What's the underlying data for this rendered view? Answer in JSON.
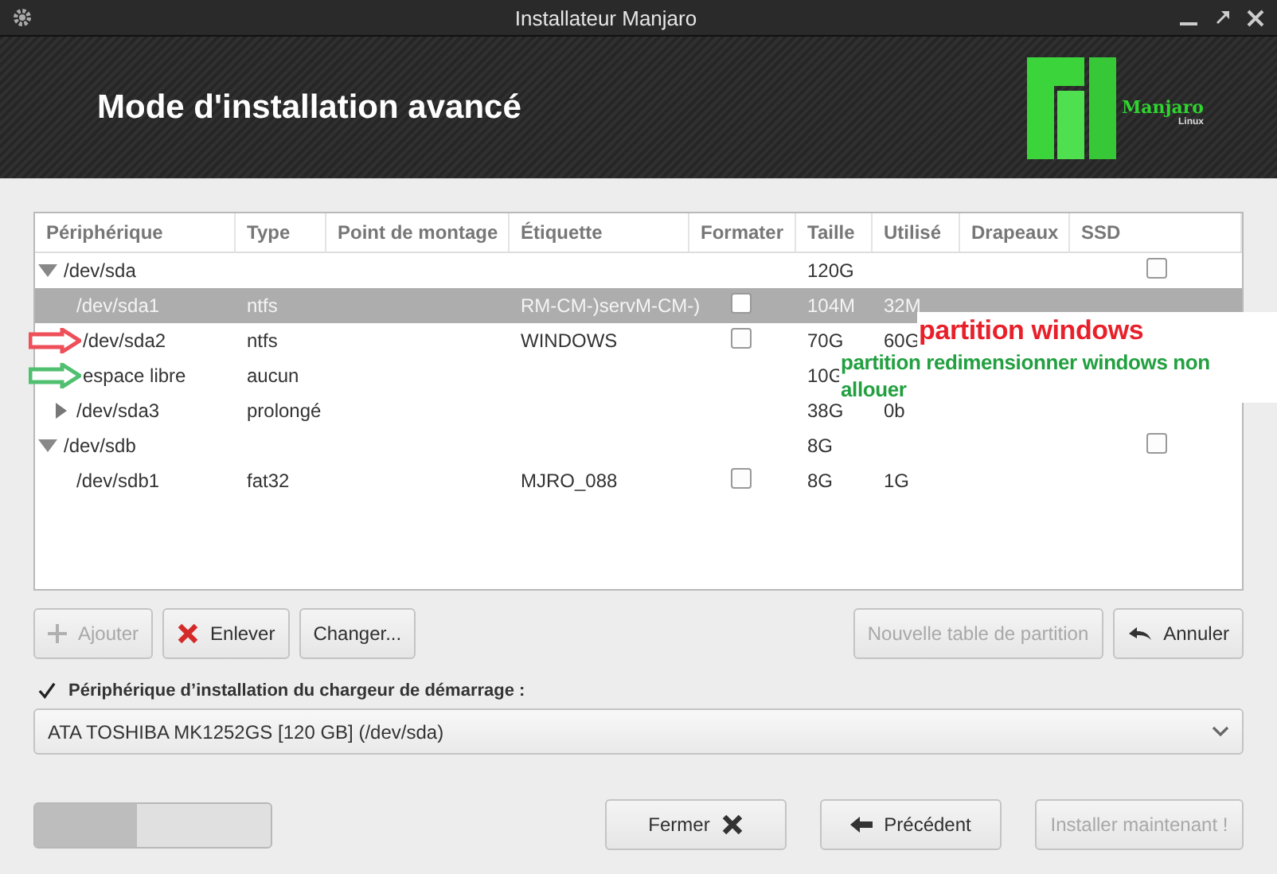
{
  "window": {
    "title": "Installateur Manjaro"
  },
  "header": {
    "title": "Mode d'installation avancé",
    "logo_name": "Manjaro",
    "logo_sub": "Linux"
  },
  "table": {
    "columns": [
      "Périphérique",
      "Type",
      "Point de montage",
      "Étiquette",
      "Formater",
      "Taille",
      "Utilisé",
      "Drapeaux",
      "SSD"
    ],
    "rows": [
      {
        "device": "/dev/sda",
        "size": "120G",
        "ssd": false,
        "expanded": true,
        "selected": false,
        "children": [
          {
            "device": "/dev/sda1",
            "type": "ntfs",
            "label": "RM-CM-)servM-CM-)",
            "format": false,
            "size": "104M",
            "used": "32M",
            "selected": true
          },
          {
            "device": "/dev/sda2",
            "type": "ntfs",
            "label": "WINDOWS",
            "format": false,
            "size": "70G",
            "used": "60G",
            "selected": false,
            "arrow": {
              "color": "#ee4f58"
            }
          },
          {
            "device": "espace libre",
            "type": "aucun",
            "size": "10G",
            "selected": false,
            "arrow": {
              "color": "#50c070"
            }
          },
          {
            "device": "/dev/sda3",
            "type": "prolongé",
            "size": "38G",
            "used": "0b",
            "expanded": false,
            "selected": false
          }
        ]
      },
      {
        "device": "/dev/sdb",
        "size": "8G",
        "ssd": false,
        "expanded": true,
        "selected": false,
        "children": [
          {
            "device": "/dev/sdb1",
            "type": "fat32",
            "label": "MJRO_088",
            "format": false,
            "size": "8G",
            "used": "1G",
            "selected": false
          }
        ]
      }
    ]
  },
  "note": [
    {
      "text": "partition windows",
      "color": "#e8202a"
    },
    {
      "text": "partition redimensionner windows non allouer",
      "color": "#22a040"
    }
  ],
  "actions": [
    {
      "label": "Ajouter",
      "disabled": true
    },
    {
      "label": "Enlever",
      "disabled": false
    },
    {
      "label": "Changer...",
      "disabled": false
    }
  ],
  "actions_right": [
    {
      "label": "Nouvelle table de partition",
      "disabled": true
    },
    {
      "label": "Annuler",
      "disabled": false
    }
  ],
  "bootloader": {
    "label": "Périphérique d’installation du chargeur de démarrage :",
    "checked": true,
    "value": "ATA TOSHIBA MK1252GS [120 GB] (/dev/sda)"
  },
  "progress": {
    "level": 0.43
  },
  "footer": [
    {
      "label": "Fermer",
      "disabled": false
    },
    {
      "label": "Précédent",
      "disabled": false
    },
    {
      "label": "Installer maintenant !",
      "disabled": true
    }
  ]
}
